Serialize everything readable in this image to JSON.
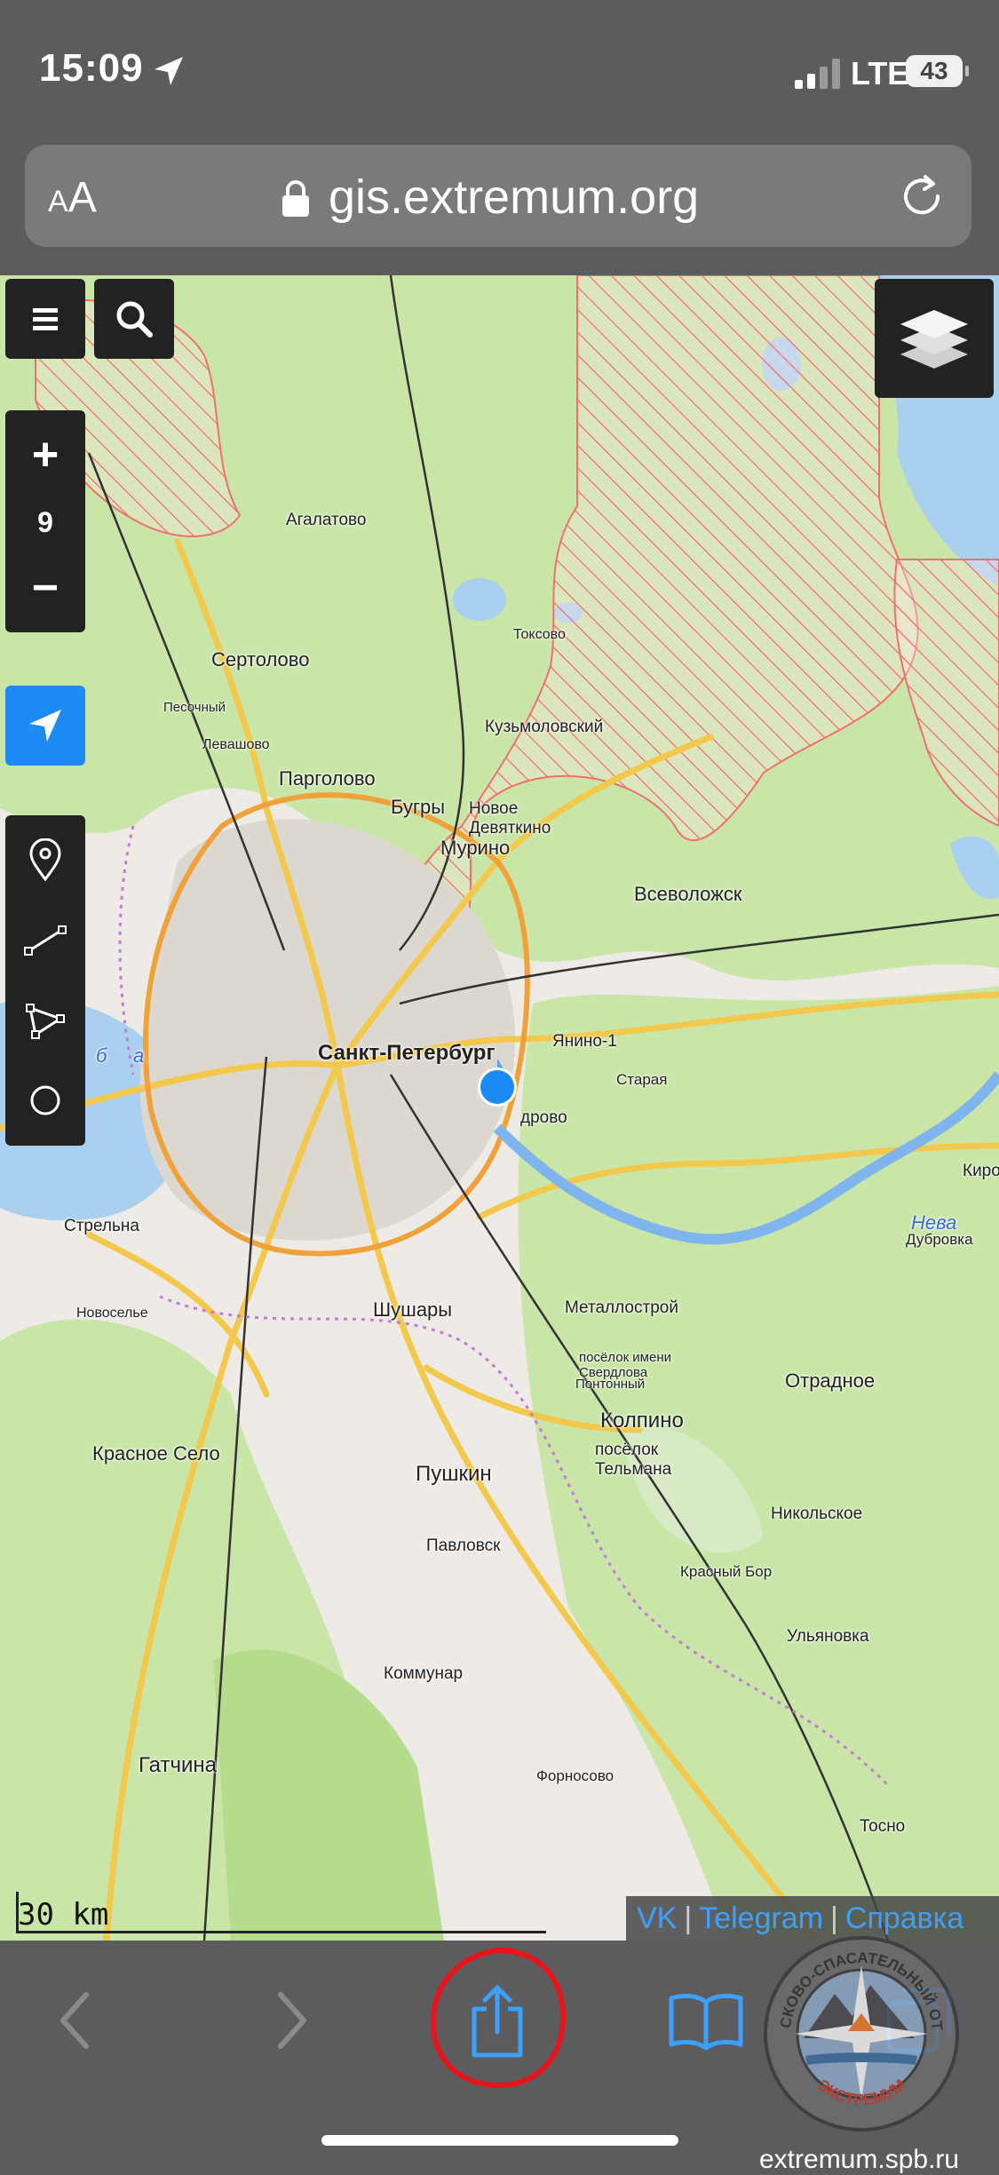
{
  "status_bar": {
    "time": "15:09",
    "network": "LTE",
    "battery": "43"
  },
  "browser": {
    "text_size_label_small": "A",
    "text_size_label_large": "A",
    "url": "gis.extremum.org"
  },
  "map": {
    "zoom_level": "9",
    "scale_label": "30 km",
    "labels": {
      "agalatovo": "Агалатово",
      "sertolovo": "Сертолово",
      "pesochny": "Песочный",
      "levashovo": "Левашово",
      "pargolovo": "Парголово",
      "bugry": "Бугры",
      "novoe_devyatkino": "Новое Девяткино",
      "murino": "Мурино",
      "toksovo": "Токсово",
      "kuzmolovsky": "Кузьмоловский",
      "vsevolozhsk": "Всеволожск",
      "spb": "Санкт-Петербург",
      "yanino": "Янино-1",
      "staraya": "Старая",
      "kudrovo": "дрово",
      "strelna": "Стрельна",
      "novoselye": "Новоселье",
      "shushary": "Шушары",
      "metallostroy": "Металлострой",
      "sverdlova": "посёлок имени Свердлова",
      "pontonny": "Понтонный",
      "otradnoe": "Отрадное",
      "kolpino": "Колпино",
      "telmana": "посёлок Тельмана",
      "krasnoe_selo": "Красное Село",
      "pushkin": "Пушкин",
      "pavlovsk": "Павловск",
      "nikolskoe": "Никольское",
      "krasny_bor": "Красный Бор",
      "ulyanovka": "Ульяновка",
      "kommunar": "Коммунар",
      "gatchina": "Гатчина",
      "fornosovo": "Форносово",
      "tosno": "Тосно",
      "kirovsk": "Киро",
      "neva": "Нева",
      "dubrovka": "Дубровка",
      "bay_letter_b": "б",
      "bay_letter_a": "а"
    },
    "footer_links": [
      "VK",
      "Telegram",
      "Справка"
    ]
  },
  "watermark": {
    "site": "extremum.spb.ru",
    "ring_text": "ПОИСКОВО-СПАСАТЕЛЬНЫЙ ОТРЯД",
    "bottom_text": "ЭКСТРЕМУМ"
  },
  "colors": {
    "accent": "#1e8bf5",
    "annotation": "#e8141b",
    "forest": "#c9e6a8",
    "toolbar": "#5c5c5e"
  }
}
